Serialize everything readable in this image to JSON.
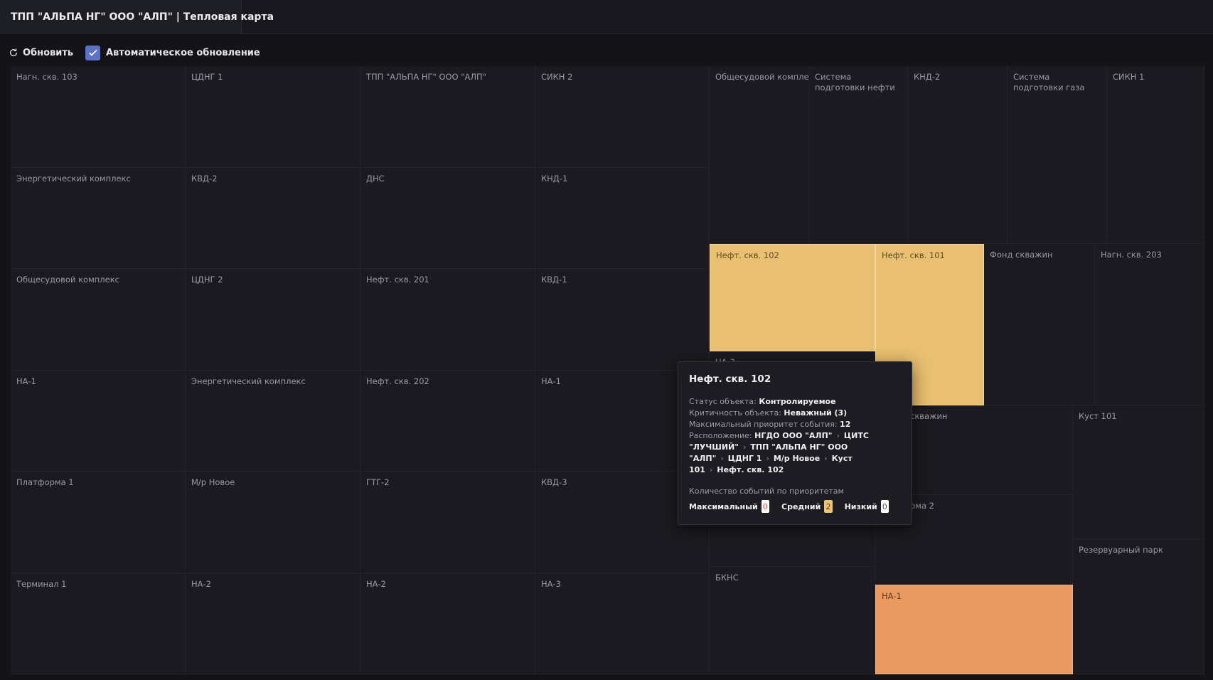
{
  "tab": {
    "title": "ТПП \"АЛЬПА НГ\" ООО \"АЛП\" | Тепловая карта"
  },
  "toolbar": {
    "refresh_label": "Обновить",
    "auto_update_label": "Автоматическое обновление",
    "auto_update_checked": true,
    "accent_color": "#5b72c7"
  },
  "heatmap": {
    "colors": {
      "empty": "#1a1a20",
      "yellow": "#e9bf71",
      "orange": "#e89a60"
    },
    "left_grid": [
      [
        "Нагн. скв. 103",
        "ЦДНГ 1",
        "ТПП \"АЛЬПА НГ\" ООО \"АЛП\"",
        "СИКН 2"
      ],
      [
        "Энергетический комплекс",
        "КВД-2",
        "ДНС",
        "КНД-1"
      ],
      [
        "Общесудовой комплекс",
        "ЦДНГ 2",
        "Нефт. скв. 201",
        "КВД-1"
      ],
      [
        "НА-1",
        "Энергетический комплекс",
        "Нефт. скв. 202",
        "НА-1"
      ],
      [
        "Платформа 1",
        "М/р Новое",
        "ГТГ-2",
        "КВД-3"
      ],
      [
        "Терминал 1",
        "НА-2",
        "НА-2",
        "НА-3"
      ]
    ],
    "right_top": [
      "Общесудовой комплекс",
      "Система подготовки нефти",
      "КНД-2",
      "Система подготовки газа",
      "СИКН 1"
    ],
    "neft_102": "Нефт. скв. 102",
    "neft_101": "Нефт. скв. 101",
    "fond": "Фонд скважин",
    "nagn_203": "Нагн. скв. 203",
    "na3_hidden": "НА-3",
    "fond2_partial": "скважин",
    "kust_101": "Куст 101",
    "platform2_partial": "рма 2",
    "rezervuar": "Резервуарный парк",
    "bkns": "БКНС",
    "na1_orange": "НА-1"
  },
  "tooltip": {
    "title": "Нефт. скв. 102",
    "status_label": "Статус объекта:",
    "status_value": "Контролируемое",
    "crit_label": "Критичность объекта:",
    "crit_value": "Неважный (3)",
    "maxprio_label": "Максимальный приоритет события:",
    "maxprio_value": "12",
    "location_label": "Расположение:",
    "location": [
      "НГДО ООО \"АЛП\"",
      "ЦИТС \"ЛУЧШИЙ\"",
      "ТПП \"АЛЬПА НГ\" ООО \"АЛП\"",
      "ЦДНГ 1",
      "М/р Новое",
      "Куст 101",
      "Нефт. скв. 102"
    ],
    "counts_title": "Количество событий по приоритетам",
    "max_label": "Максимальный",
    "max_value": "0",
    "mid_label": "Средний",
    "mid_value": "2",
    "low_label": "Низкий",
    "low_value": "0"
  }
}
